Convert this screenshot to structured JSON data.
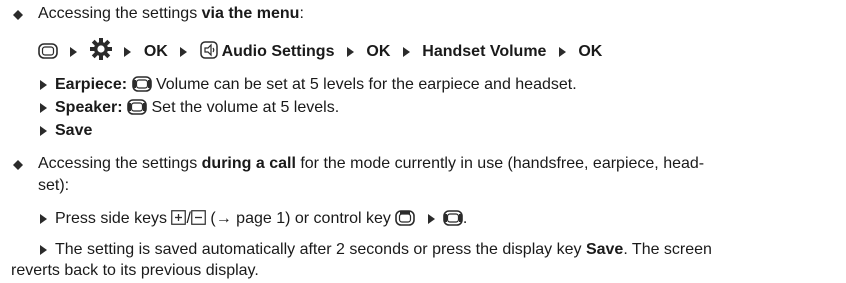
{
  "colors": {
    "bullet": "#2b2b2b",
    "arrow": "#2b2b2b",
    "icon_stroke": "#2b2b2b"
  },
  "section1": {
    "intro_prefix": "Accessing the settings ",
    "intro_bold": "via the menu",
    "intro_suffix": ":",
    "path": {
      "ok1": "OK",
      "audio_settings": "Audio Settings",
      "ok2": "OK",
      "handset_volume": "Handset Volume",
      "ok3": "OK"
    },
    "steps": [
      {
        "bold": "Earpiece:",
        "text": " Volume can be set at 5 levels for the earpiece and headset."
      },
      {
        "bold": "Speaker:",
        "text": " Set the volume at 5 levels."
      },
      {
        "bold": "Save",
        "text": ""
      }
    ]
  },
  "section2": {
    "intro_prefix": "Accessing the settings ",
    "intro_bold": "during a call",
    "intro_suffix": " for the mode currently in use (handsfree, earpiece, head-",
    "intro_line2": "set):",
    "step1": {
      "prefix": "Press side keys ",
      "sep": "/",
      "middle": " (",
      "arrow": "→",
      "page_ref": " page 1) or control key ",
      "end": "."
    },
    "step2": {
      "line1_prefix": "The setting is saved automatically after 2 seconds or press the display key ",
      "line1_bold": "Save",
      "line1_suffix": ". The screen",
      "line2": "reverts back to its previous display."
    }
  },
  "icons": {
    "menu_key": "menu-control-key-icon",
    "settings_gear": "settings-gear-icon",
    "audio_settings": "audio-settings-icon",
    "control_key_leftright": "control-key-left-right-icon",
    "plus_key": "side-key-plus-icon",
    "minus_key": "side-key-minus-icon",
    "control_key_up": "control-key-up-icon"
  }
}
